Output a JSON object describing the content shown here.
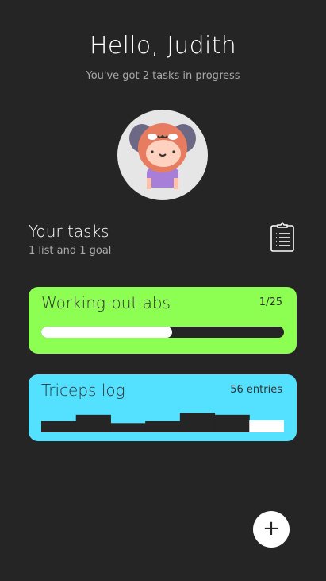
{
  "header": {
    "title": "Hello, Judith",
    "subtitle": "You've got 2 tasks in progress"
  },
  "avatar": {
    "icon": "girl-in-dog-hood-avatar"
  },
  "tasks": {
    "title": "Your tasks",
    "subtitle": "1 list and 1 goal",
    "icon": "clipboard-list-icon"
  },
  "cards": [
    {
      "title": "Working-out abs",
      "meta": "1/25",
      "progress": 0.54,
      "color": "#8cff52"
    },
    {
      "title": "Triceps log",
      "meta": "56 entries",
      "color": "#54e0ff",
      "histogram": [
        12,
        19,
        10,
        12,
        21,
        19,
        13
      ]
    }
  ],
  "fab": {
    "label": "+"
  }
}
